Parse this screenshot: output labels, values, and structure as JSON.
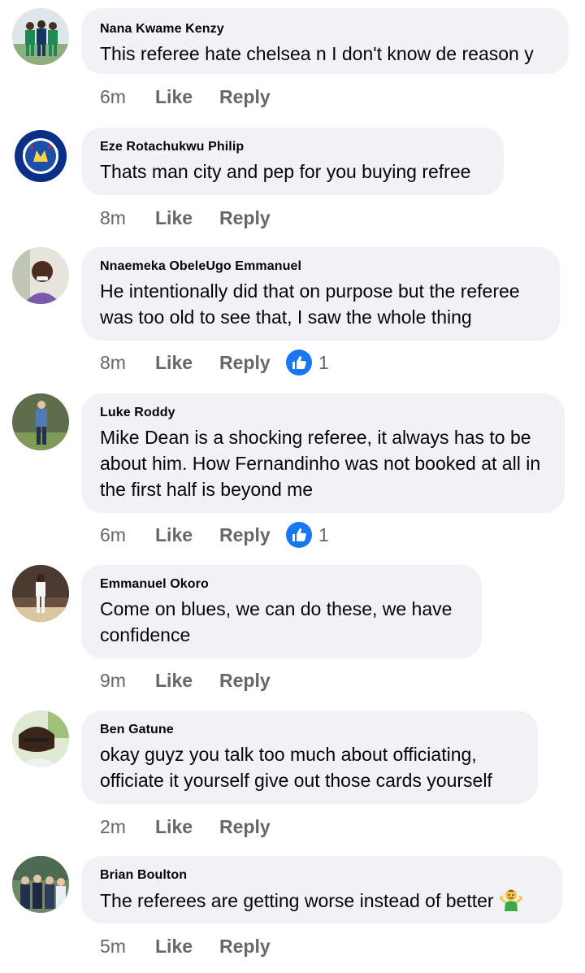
{
  "comments": [
    {
      "author": "Nana Kwame Kenzy",
      "text": "This referee hate chelsea n I don't know de reason y",
      "time": "6m",
      "like_label": "Like",
      "reply_label": "Reply",
      "avatar_icon": "team-photo-avatar"
    },
    {
      "author": "Eze Rotachukwu Philip",
      "text": "Thats man city and pep for you buying refree",
      "time": "8m",
      "like_label": "Like",
      "reply_label": "Reply",
      "avatar_icon": "chelsea-crest-avatar"
    },
    {
      "author": "Nnaemeka ObeleUgo Emmanuel",
      "text": "He intentionally did that on purpose but the referee was too old to see that, I saw the whole thing",
      "time": "8m",
      "like_label": "Like",
      "reply_label": "Reply",
      "reaction_count": "1",
      "reaction_icon": "thumbs-up-icon",
      "avatar_icon": "portrait-avatar"
    },
    {
      "author": "Luke Roddy",
      "text": "Mike Dean is a shocking referee, it always has to be about him. How Fernandinho was not booked at all in the first half is beyond me",
      "time": "6m",
      "like_label": "Like",
      "reply_label": "Reply",
      "reaction_count": "1",
      "reaction_icon": "thumbs-up-icon",
      "avatar_icon": "standing-man-avatar"
    },
    {
      "author": "Emmanuel Okoro",
      "text": "Come on blues, we can do these, we have confidence",
      "time": "9m",
      "like_label": "Like",
      "reply_label": "Reply",
      "avatar_icon": "standing-man-avatar"
    },
    {
      "author": "Ben Gatune",
      "text": "okay guyz you talk too much about officiating, officiate it yourself give out those cards yourself",
      "time": "2m",
      "like_label": "Like",
      "reply_label": "Reply",
      "avatar_icon": "selfie-avatar"
    },
    {
      "author": "Brian Boulton",
      "text": "The referees are getting worse instead of better",
      "emoji_icon": "man-shrugging-emoji",
      "time": "5m",
      "like_label": "Like",
      "reply_label": "Reply",
      "avatar_icon": "group-photo-avatar"
    }
  ],
  "colors": {
    "bubble": "#f0f2f5",
    "meta_text": "#65676b",
    "like_blue": "#1877f2"
  }
}
